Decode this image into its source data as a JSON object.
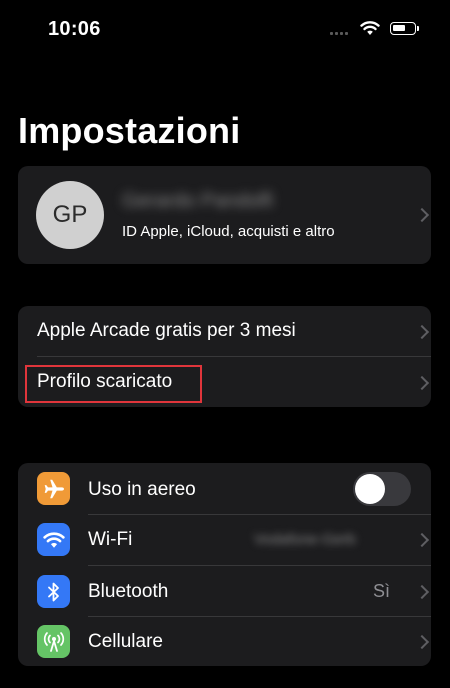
{
  "status_bar": {
    "time": "10:06"
  },
  "title": "Impostazioni",
  "profile": {
    "initials": "GP",
    "name": "Gerardo Pandolfi",
    "subtitle": "ID Apple, iCloud, acquisti e altro"
  },
  "group2": {
    "items": [
      {
        "label": "Apple Arcade gratis per 3 mesi"
      },
      {
        "label": "Profilo scaricato",
        "highlighted": true
      }
    ]
  },
  "settings": {
    "airplane": {
      "label": "Uso in aereo",
      "icon": "airplane-icon",
      "color": "#f09a37",
      "enabled": false
    },
    "wifi": {
      "label": "Wi-Fi",
      "icon": "wifi-icon",
      "color": "#3478f6",
      "value": "Vodafone-Gerb"
    },
    "bluetooth": {
      "label": "Bluetooth",
      "icon": "bluetooth-icon",
      "color": "#3478f6",
      "value": "Sì"
    },
    "cellular": {
      "label": "Cellulare",
      "icon": "antenna-icon",
      "color": "#65c466"
    }
  },
  "colors": {
    "background": "#000000",
    "group_background": "#1c1c1e",
    "highlight_border": "#e0353b"
  }
}
